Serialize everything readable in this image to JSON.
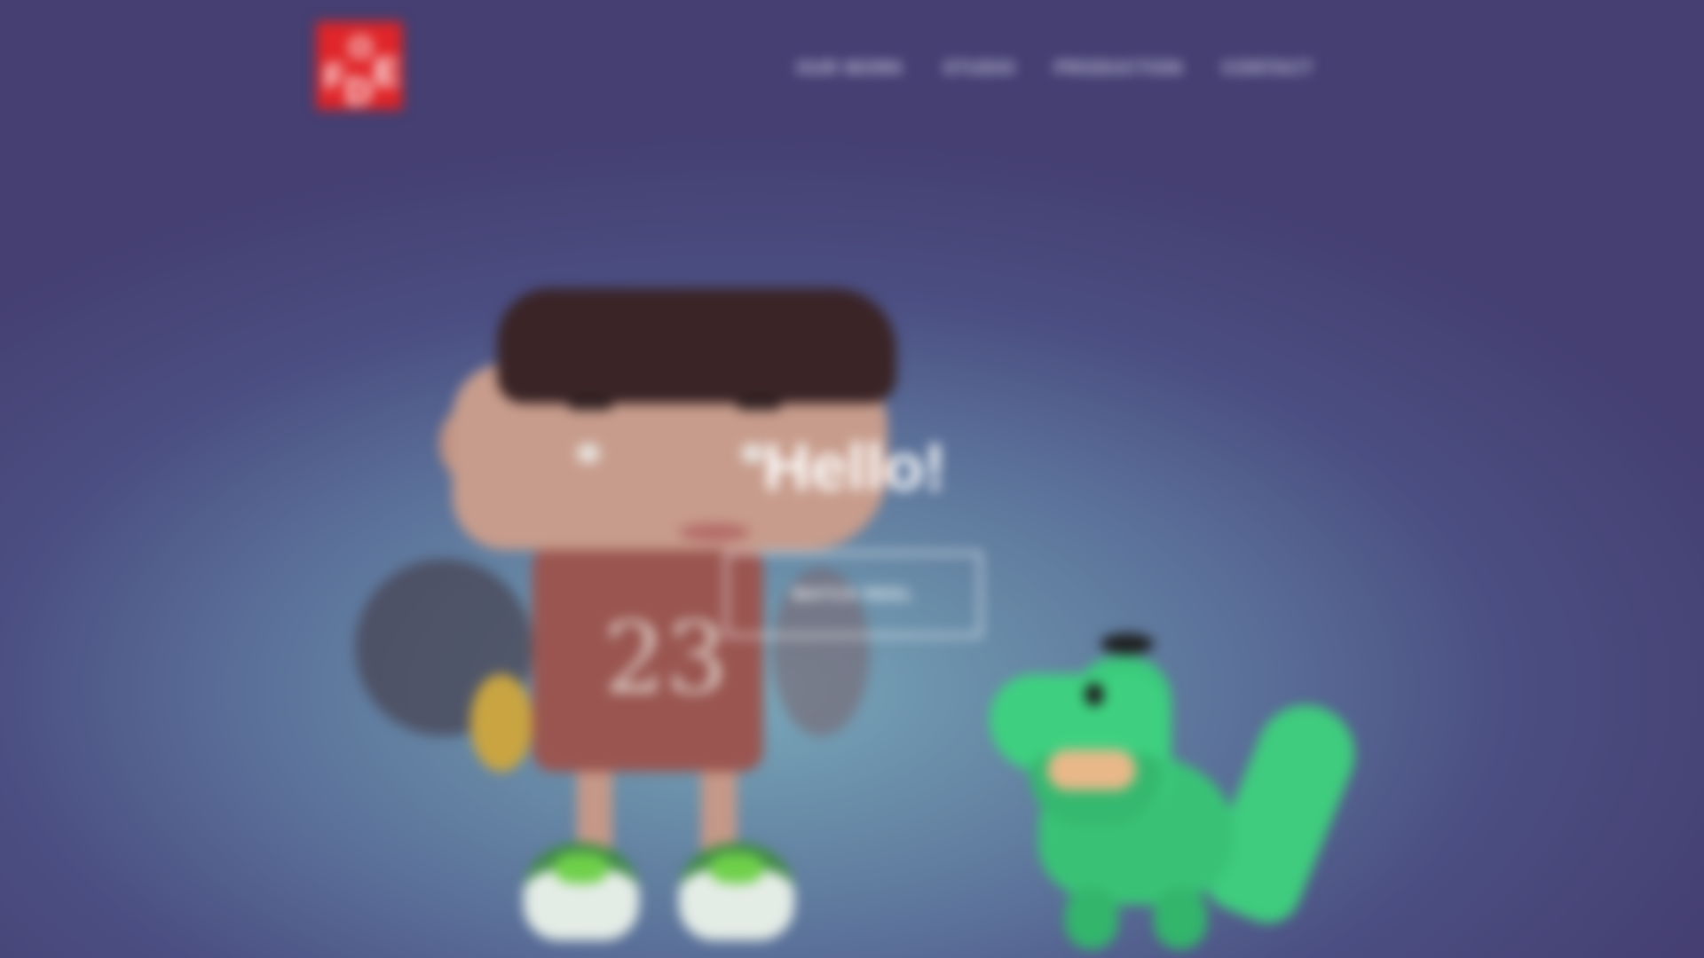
{
  "logo": {
    "letters": [
      "F",
      "O",
      "E",
      "D"
    ],
    "brand_color": "#e0262a"
  },
  "nav": {
    "items": [
      {
        "label": "OUR WORK"
      },
      {
        "label": "STUDIO"
      },
      {
        "label": "PRODUCTION"
      },
      {
        "label": "CONTACT"
      }
    ]
  },
  "hero": {
    "title": "Hello!",
    "button_label": "WATCH REEL"
  },
  "illustration": {
    "jersey_number": "23",
    "characters": [
      "boy-character",
      "dinosaur-character"
    ]
  },
  "colors": {
    "background_top": "#453f72",
    "background_center": "#7aa8bb",
    "accent": "#e0262a"
  }
}
